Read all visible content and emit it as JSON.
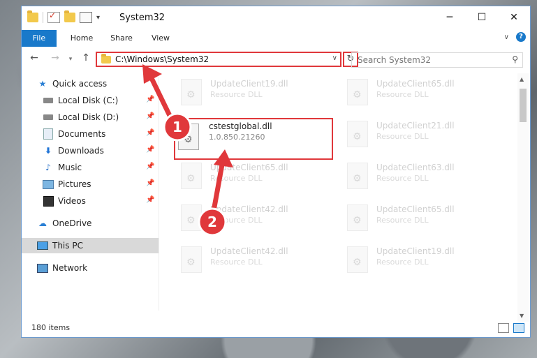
{
  "window": {
    "title": "System32"
  },
  "ribbon": {
    "tabs": [
      "File",
      "Home",
      "Share",
      "View"
    ]
  },
  "address": {
    "path": "C:\\Windows\\System32"
  },
  "search": {
    "placeholder": "Search System32"
  },
  "sidebar": {
    "items": [
      {
        "label": "Quick access",
        "icon": "star-icon"
      },
      {
        "label": "Local Disk (C:)",
        "icon": "drive-icon",
        "pinned": true
      },
      {
        "label": "Local Disk (D:)",
        "icon": "drive-icon",
        "pinned": true
      },
      {
        "label": "Documents",
        "icon": "documents-icon",
        "pinned": true
      },
      {
        "label": "Downloads",
        "icon": "download-icon",
        "pinned": true
      },
      {
        "label": "Music",
        "icon": "music-icon",
        "pinned": true
      },
      {
        "label": "Pictures",
        "icon": "pictures-icon",
        "pinned": true
      },
      {
        "label": "Videos",
        "icon": "videos-icon",
        "pinned": true
      },
      {
        "label": "OneDrive",
        "icon": "cloud-icon"
      },
      {
        "label": "This PC",
        "icon": "computer-icon",
        "selected": true
      },
      {
        "label": "Network",
        "icon": "network-icon"
      }
    ]
  },
  "files": [
    {
      "name": "UpdateClient19.dll",
      "type": "Resource DLL"
    },
    {
      "name": "UpdateClient65.dll",
      "type": "Resource DLL"
    },
    {
      "name": "cstestglobal.dll",
      "type": "1.0.850.21260",
      "highlighted": true
    },
    {
      "name": "UpdateClient21.dll",
      "type": "Resource DLL"
    },
    {
      "name": "UpdateClient65.dll",
      "type": "Resource DLL"
    },
    {
      "name": "UpdateClient63.dll",
      "type": "Resource DLL"
    },
    {
      "name": "UpdateClient42.dll",
      "type": "Resource DLL"
    },
    {
      "name": "UpdateClient65.dll",
      "type": "Resource DLL"
    },
    {
      "name": "UpdateClient42.dll",
      "type": "Resource DLL"
    },
    {
      "name": "UpdateClient19.dll",
      "type": "Resource DLL"
    }
  ],
  "status": {
    "item_count": "180 items"
  },
  "annotations": {
    "step1": "1",
    "step2": "2",
    "color": "#e0383b"
  }
}
